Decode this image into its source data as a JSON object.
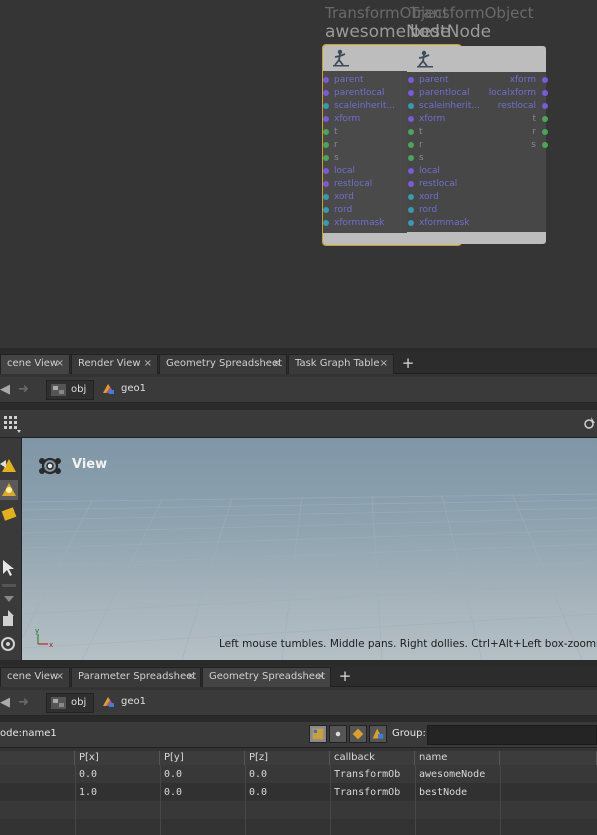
{
  "network": {
    "nodes": [
      {
        "type_label": "TransformObject",
        "name": "awesomeNode",
        "inputs": [
          "parent",
          "parentlocal",
          "scaleinherit...",
          "xform",
          "t",
          "r",
          "s",
          "local",
          "restlocal",
          "xord",
          "rord",
          "xformmask"
        ],
        "outputs": []
      },
      {
        "type_label": "TransformObject",
        "name": "bestNode",
        "inputs": [
          "parent",
          "parentlocal",
          "scaleinherit...",
          "xform",
          "t",
          "r",
          "s",
          "local",
          "restlocal",
          "xord",
          "rord",
          "xformmask"
        ],
        "outputs": [
          "xform",
          "localxform",
          "restlocal",
          "t",
          "r",
          "s"
        ]
      }
    ],
    "colors": {
      "selected_border": "#c9a227",
      "port_purple": "#7a5ad8",
      "port_teal": "#3a98b0",
      "port_green": "#4da35a"
    }
  },
  "top_tabs": {
    "tabs": [
      {
        "label": "cene View",
        "close": "×"
      },
      {
        "label": "Render View",
        "close": "×"
      },
      {
        "label": "Geometry Spreadsheet",
        "close": "×"
      },
      {
        "label": "Task Graph Table",
        "close": "×"
      }
    ],
    "add": "+"
  },
  "top_path": {
    "crumbs": [
      "obj",
      "geo1"
    ]
  },
  "viewport": {
    "view_label": "View",
    "help_text": "Left mouse tumbles. Middle pans. Right dollies. Ctrl+Alt+Left box-zooms. Ctrl+",
    "axis_y": "y",
    "axis_x": "x"
  },
  "bottom_tabs": {
    "tabs": [
      {
        "label": "cene View",
        "close": "×"
      },
      {
        "label": "Parameter Spreadsheet",
        "close": "×"
      },
      {
        "label": "Geometry Spreadsheet",
        "close": "×"
      }
    ],
    "active_index": 2,
    "add": "+"
  },
  "bottom_path": {
    "crumbs": [
      "obj",
      "geo1"
    ]
  },
  "spreadsheet": {
    "node_label": "ode:",
    "node_value": "name1",
    "group_label": "Group:",
    "group_value": "",
    "columns": [
      "P[x]",
      "P[y]",
      "P[z]",
      "callback",
      "name"
    ],
    "rows": [
      [
        "0.0",
        "0.0",
        "0.0",
        "TransformOb",
        "awesomeNode"
      ],
      [
        "1.0",
        "0.0",
        "0.0",
        "TransformOb",
        "bestNode"
      ]
    ]
  }
}
